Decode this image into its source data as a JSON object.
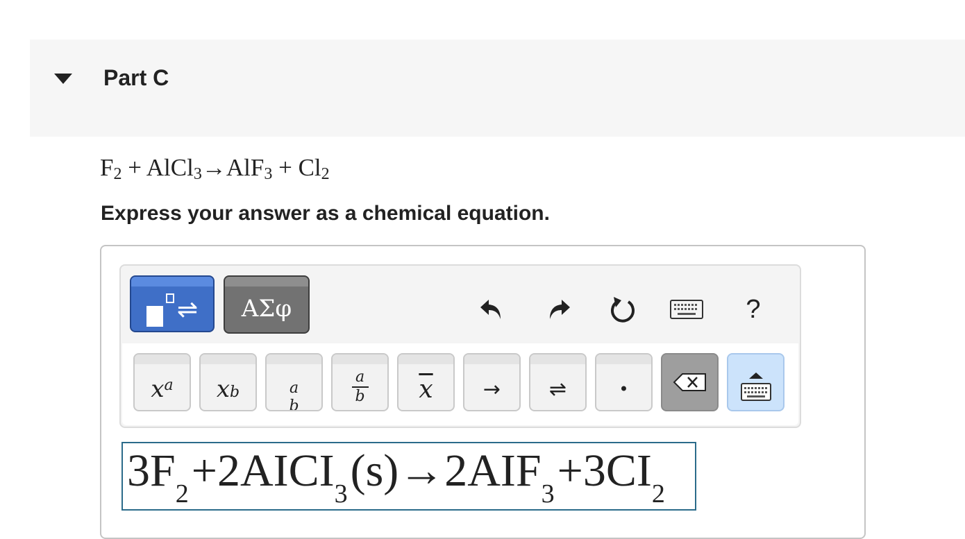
{
  "part": {
    "title": "Part C",
    "toggle_icon": "caret-down-icon"
  },
  "question": {
    "equation": {
      "t1": "F",
      "s1": "2",
      "t2": " + AlCl",
      "s2": "3",
      "t3": "→AlF",
      "s3": "3",
      "t4": " + Cl",
      "s4": "2"
    },
    "instruction": "Express your answer as a chemical equation."
  },
  "toolbar": {
    "tabs": [
      {
        "name": "templates",
        "icon": "template-arrows-icon",
        "selected": true
      },
      {
        "name": "greek",
        "label": "ΑΣφ",
        "selected": false
      }
    ],
    "actions": [
      {
        "name": "undo",
        "icon": "undo-icon"
      },
      {
        "name": "redo",
        "icon": "redo-icon"
      },
      {
        "name": "reset",
        "icon": "reset-icon"
      },
      {
        "name": "keyboard-shortcuts",
        "icon": "keyboard-icon"
      },
      {
        "name": "help",
        "label": "?"
      }
    ],
    "keys": [
      {
        "name": "superscript",
        "icon": "superscript-icon"
      },
      {
        "name": "subscript",
        "icon": "subscript-icon"
      },
      {
        "name": "stacked",
        "icon": "stacked-fraction-icon"
      },
      {
        "name": "fraction",
        "icon": "fraction-icon"
      },
      {
        "name": "overbar",
        "icon": "overbar-icon"
      },
      {
        "name": "reaction-arrow",
        "label": "→"
      },
      {
        "name": "equilibrium-arrow",
        "label": "⇌"
      },
      {
        "name": "dot",
        "label": "•"
      },
      {
        "name": "backspace",
        "icon": "backspace-icon"
      },
      {
        "name": "toggle-keyboard",
        "icon": "keyboard-toggle-icon"
      }
    ],
    "colors": {
      "tab_active": "#3f6fc7",
      "tab_inactive": "#727272",
      "keyboard_key": "#cce3fb"
    }
  },
  "answer": {
    "c1": "3F",
    "s1": "2",
    "c2": "+2AICI",
    "s2": "3",
    "c3": "(s)→2AIF",
    "s3": "3",
    "c4": "+3CI",
    "s4": "2"
  }
}
